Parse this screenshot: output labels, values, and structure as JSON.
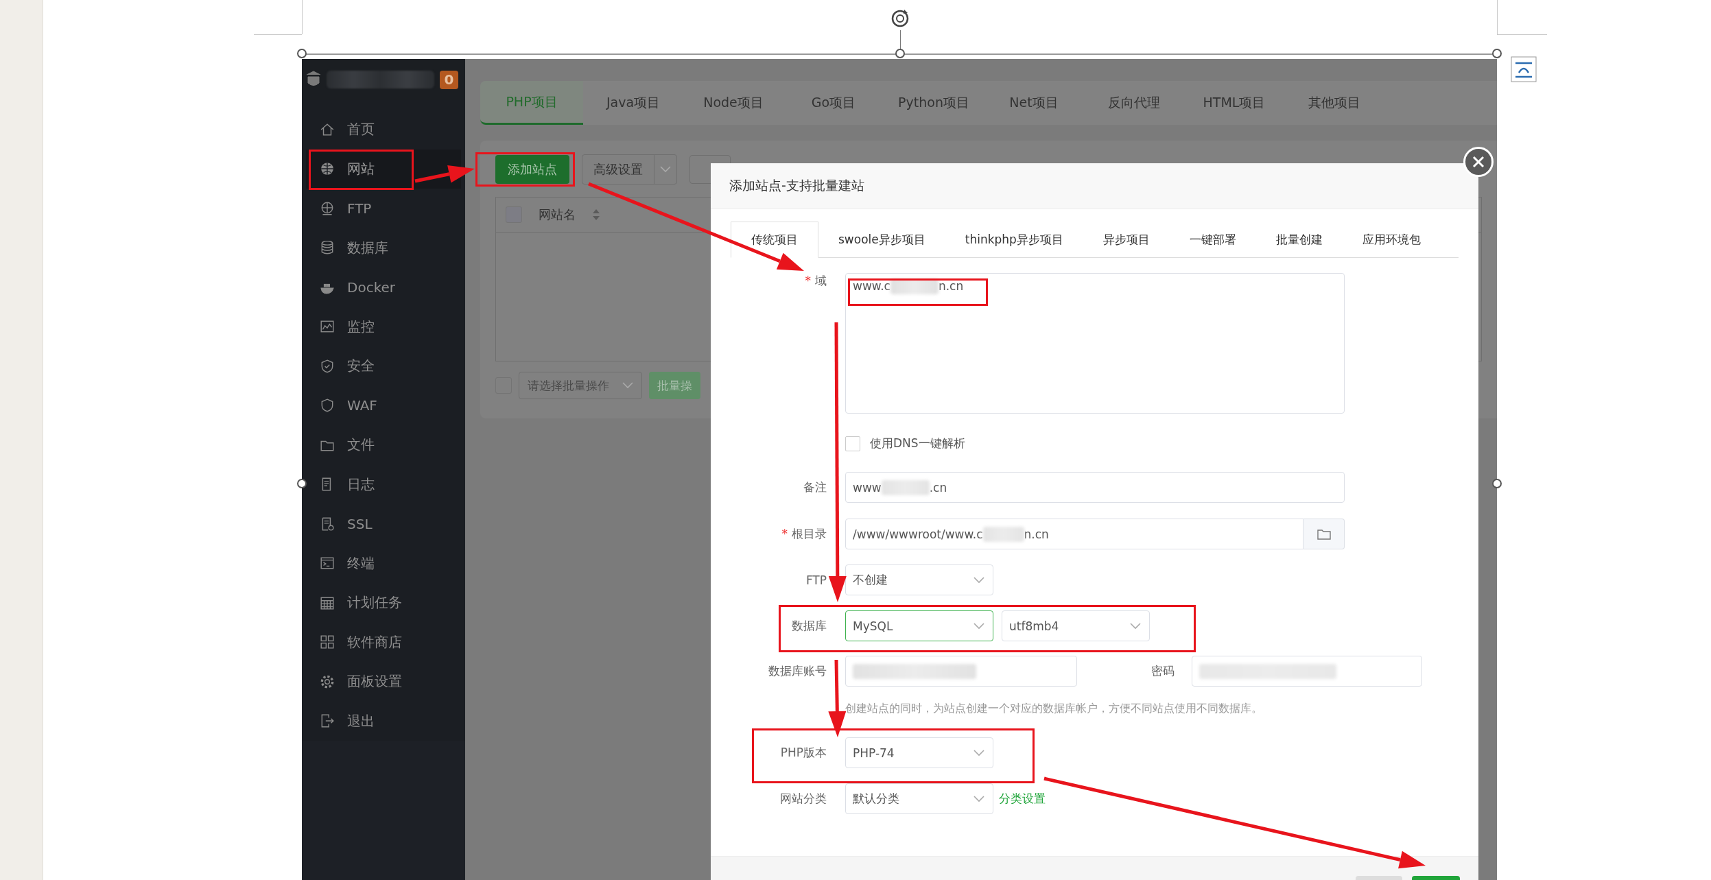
{
  "sidebar": {
    "badge": "0",
    "items": [
      {
        "label": "首页",
        "selected": false
      },
      {
        "label": "网站",
        "selected": true
      },
      {
        "label": "FTP",
        "selected": false
      },
      {
        "label": "数据库",
        "selected": false
      },
      {
        "label": "Docker",
        "selected": false
      },
      {
        "label": "监控",
        "selected": false
      },
      {
        "label": "安全",
        "selected": false
      },
      {
        "label": "WAF",
        "selected": false
      },
      {
        "label": "文件",
        "selected": false
      },
      {
        "label": "日志",
        "selected": false
      },
      {
        "label": "SSL",
        "selected": false
      },
      {
        "label": "终端",
        "selected": false
      },
      {
        "label": "计划任务",
        "selected": false
      },
      {
        "label": "软件商店",
        "selected": false
      },
      {
        "label": "面板设置",
        "selected": false
      },
      {
        "label": "退出",
        "selected": false
      }
    ]
  },
  "project_tabs": [
    {
      "label": "PHP项目",
      "selected": true
    },
    {
      "label": "Java项目",
      "selected": false
    },
    {
      "label": "Node项目",
      "selected": false
    },
    {
      "label": "Go项目",
      "selected": false
    },
    {
      "label": "Python项目",
      "selected": false
    },
    {
      "label": "Net项目",
      "selected": false
    },
    {
      "label": "反向代理",
      "selected": false
    },
    {
      "label": "HTML项目",
      "selected": false
    },
    {
      "label": "其他项目",
      "selected": false
    }
  ],
  "toolbar": {
    "add_site_button": "添加站点",
    "advanced_button": "高级设置"
  },
  "table": {
    "columns": [
      "网站名"
    ],
    "select_all_checked": false
  },
  "batch": {
    "checked": false,
    "placeholder": "请选择批量操作",
    "button": "批量操"
  },
  "dialog": {
    "title": "添加站点-支持批量建站",
    "tabs": [
      {
        "label": "传统项目",
        "selected": true
      },
      {
        "label": "swoole异步项目",
        "selected": false
      },
      {
        "label": "thinkphp异步项目",
        "selected": false
      },
      {
        "label": "异步项目",
        "selected": false
      },
      {
        "label": "一键部署",
        "selected": false
      },
      {
        "label": "批量创建",
        "selected": false
      },
      {
        "label": "应用环境包",
        "selected": false
      }
    ],
    "form": {
      "domain": {
        "required_mark": "*",
        "label": "域",
        "prefix": "www.c",
        "suffix": "n.cn"
      },
      "dns": {
        "label": "使用DNS一键解析",
        "checked": false
      },
      "note": {
        "label": "备注",
        "prefix": "www",
        "suffix": ".cn"
      },
      "root": {
        "required_mark": "*",
        "label": "根目录",
        "prefix": "/www/wwwroot/www.c",
        "suffix": "n.cn"
      },
      "ftp": {
        "label": "FTP",
        "value": "不创建"
      },
      "database": {
        "label": "数据库",
        "type": "MySQL",
        "charset": "utf8mb4"
      },
      "db_account": {
        "label": "数据库账号"
      },
      "password": {
        "label": "密码"
      },
      "hint": "创建站点的同时，为站点创建一个对应的数据库帐户，方便不同站点使用不同数据库。",
      "php": {
        "label": "PHP版本",
        "value": "PHP-74"
      },
      "category": {
        "label": "网站分类",
        "value": "默认分类",
        "link": "分类设置"
      }
    }
  }
}
